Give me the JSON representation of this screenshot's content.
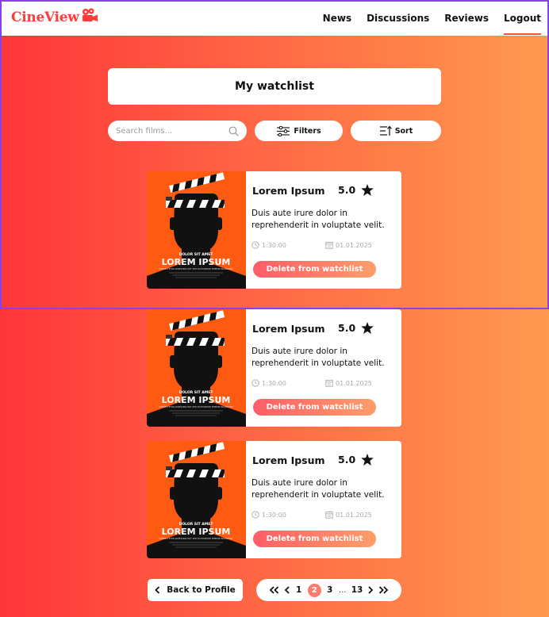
{
  "app": {
    "logo_text": "CineView",
    "nav": [
      "News",
      "Discussions",
      "Reviews",
      "Logout"
    ],
    "active_nav": "Logout"
  },
  "page": {
    "title": "My watchlist",
    "search_placeholder": "Search films...",
    "filters_label": "Filters",
    "sort_label": "Sort"
  },
  "poster": {
    "small_text": "DOLOR SIT AMET",
    "big_text": "LOREM IPSUM",
    "credits": "CONSECTETUR ADIPISCING ELIT SED DO EIUSMOD TEMPOR INCIDIDUNT"
  },
  "cards": [
    {
      "title": "Lorem Ipsum",
      "rating": "5.0",
      "description": "Duis aute irure dolor in reprehenderit in voluptate velit.",
      "duration": "1:30:00",
      "date": "01.01.2025",
      "action": "Delete from watchlist"
    },
    {
      "title": "Lorem Ipsum",
      "rating": "5.0",
      "description": "Duis aute irure dolor in reprehenderit in voluptate velit.",
      "duration": "1:30:00",
      "date": "01.01.2025",
      "action": "Delete from watchlist"
    },
    {
      "title": "Lorem Ipsum",
      "rating": "5.0",
      "description": "Duis aute irure dolor in reprehenderit in voluptate velit.",
      "duration": "1:30:00",
      "date": "01.01.2025",
      "action": "Delete from watchlist"
    }
  ],
  "footer": {
    "back_label": "Back to Profile",
    "pages": [
      "1",
      "2",
      "3",
      "...",
      "13"
    ],
    "current_page": "2"
  },
  "colors": {
    "brand": "#ff3c3c",
    "gradient_start": "#ff353a",
    "gradient_end": "#ff9a4f",
    "poster_bg": "#ff5a12",
    "selection_outline": "#8a3ff0"
  }
}
